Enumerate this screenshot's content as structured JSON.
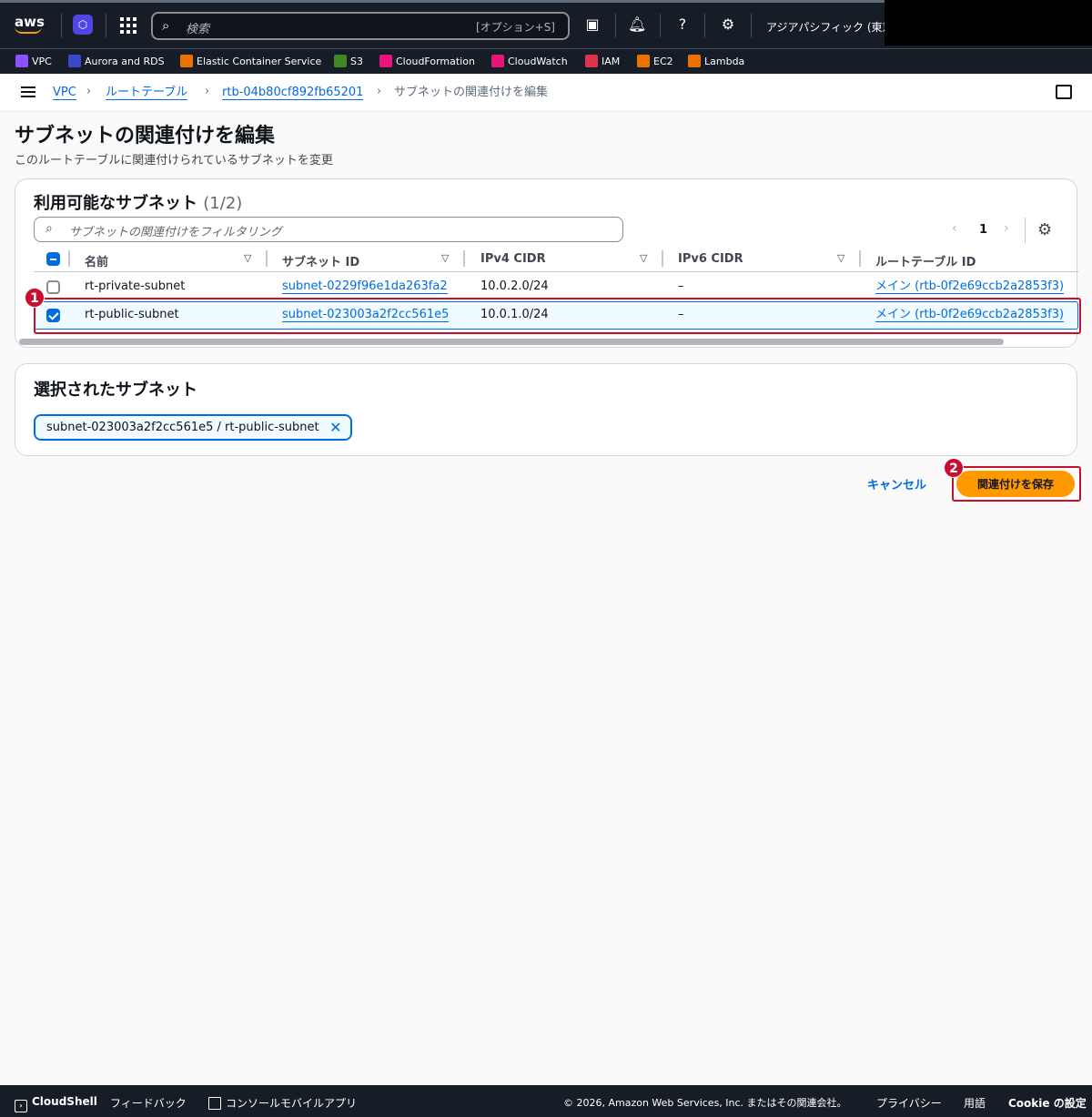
{
  "topnav": {
    "logo": "aws",
    "search_placeholder": "検索",
    "search_shortcut": "[オプション+S]",
    "region": "アジアパシフィック (東京)"
  },
  "favorites": [
    {
      "label": "VPC",
      "color": "#8c4fff"
    },
    {
      "label": "Aurora and RDS",
      "color": "#3b48cc"
    },
    {
      "label": "Elastic Container Service",
      "color": "#ed7100"
    },
    {
      "label": "S3",
      "color": "#3f8624"
    },
    {
      "label": "CloudFormation",
      "color": "#e7157b"
    },
    {
      "label": "CloudWatch",
      "color": "#e7157b"
    },
    {
      "label": "IAM",
      "color": "#dd344c"
    },
    {
      "label": "EC2",
      "color": "#ed7100"
    },
    {
      "label": "Lambda",
      "color": "#ed7100"
    }
  ],
  "breadcrumb": {
    "items": [
      "VPC",
      "ルートテーブル",
      "rtb-04b80cf892fb65201"
    ],
    "current": "サブネットの関連付けを編集"
  },
  "page": {
    "title": "サブネットの関連付けを編集",
    "description": "このルートテーブルに関連付けられているサブネットを変更"
  },
  "available": {
    "title": "利用可能なサブネット",
    "count": "(1/2)",
    "filter_placeholder": "サブネットの関連付けをフィルタリング",
    "page_number": "1",
    "columns": [
      "名前",
      "サブネット ID",
      "IPv4 CIDR",
      "IPv6 CIDR",
      "ルートテーブル ID"
    ],
    "rows": [
      {
        "name": "rt-private-subnet",
        "subnet_id": "subnet-0229f96e1da263fa2",
        "ipv4": "10.0.2.0/24",
        "ipv6": "–",
        "route_table": "メイン (rtb-0f2e69ccb2a2853f3)",
        "checked": false
      },
      {
        "name": "rt-public-subnet",
        "subnet_id": "subnet-023003a2f2cc561e5",
        "ipv4": "10.0.1.0/24",
        "ipv6": "–",
        "route_table": "メイン (rtb-0f2e69ccb2a2853f3)",
        "checked": true
      }
    ]
  },
  "selected": {
    "title": "選択されたサブネット",
    "token": "subnet-023003a2f2cc561e5 / rt-public-subnet"
  },
  "actions": {
    "cancel": "キャンセル",
    "save": "関連付けを保存"
  },
  "annotations": {
    "badge1": "1",
    "badge2": "2",
    "color": "#c8102e"
  },
  "footer": {
    "cloudshell": "CloudShell",
    "feedback": "フィードバック",
    "mobile": "コンソールモバイルアプリ",
    "copyright": "© 2026, Amazon Web Services, Inc. またはその関連会社。",
    "privacy": "プライバシー",
    "terms": "用語",
    "cookie": "Cookie の設定"
  }
}
